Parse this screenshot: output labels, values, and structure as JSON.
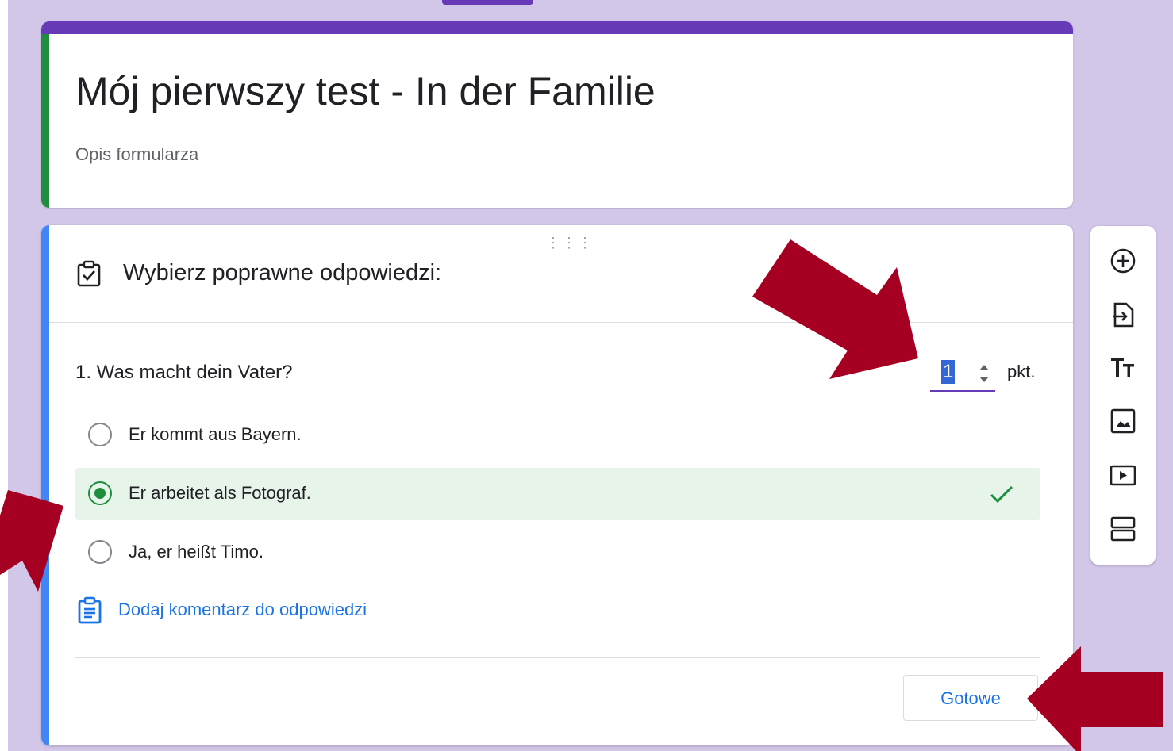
{
  "form": {
    "title": "Mój pierwszy test - In der Familie",
    "description": "Opis formularza"
  },
  "question_card": {
    "header": "Wybierz poprawne odpowiedzi:",
    "question": "1. Was macht dein Vater?",
    "points_value": "1",
    "points_unit": "pkt.",
    "options": [
      {
        "label": "Er kommt aus Bayern.",
        "selected": false,
        "correct": false
      },
      {
        "label": "Er arbeitet als Fotograf.",
        "selected": true,
        "correct": true
      },
      {
        "label": "Ja, er heißt Timo.",
        "selected": false,
        "correct": false
      }
    ],
    "feedback_link": "Dodaj komentarz do odpowiedzi",
    "done_button": "Gotowe"
  },
  "toolbar": {
    "items": [
      "add-question-icon",
      "import-questions-icon",
      "add-title-icon",
      "add-image-icon",
      "add-video-icon",
      "add-section-icon"
    ]
  },
  "colors": {
    "theme": "#673ab7",
    "background": "#d2c6e9",
    "correct": "#1e8e3e",
    "correct_bg": "#e6f4ea",
    "link": "#1a73e8",
    "arrows": "#a50021"
  }
}
